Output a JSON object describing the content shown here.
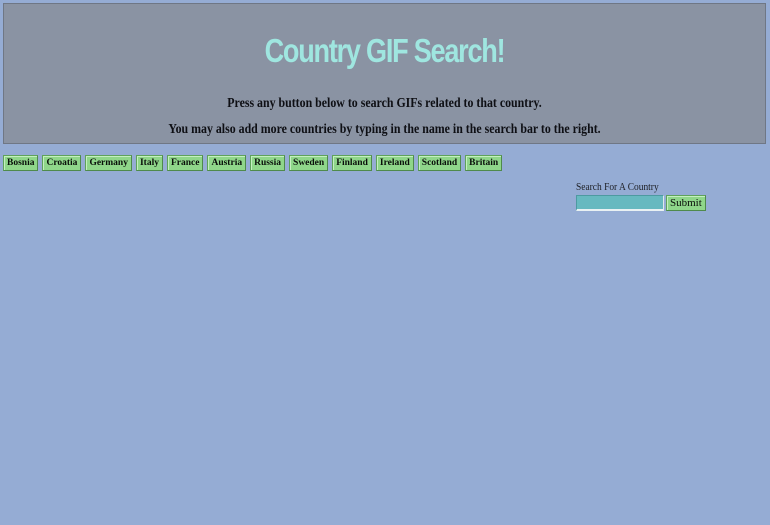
{
  "header": {
    "title": "Country GIF Search!",
    "instruction_1": "Press any button below to search GIFs related to that country.",
    "instruction_2": "You may also add more countries by typing in the name in the search bar to the right."
  },
  "countries": [
    "Bosnia",
    "Croatia",
    "Germany",
    "Italy",
    "France",
    "Austria",
    "Russia",
    "Sweden",
    "Finland",
    "Ireland",
    "Scotland",
    "Britain"
  ],
  "search": {
    "label": "Search For A Country",
    "value": "",
    "submit_label": "Submit"
  },
  "colors": {
    "page_background": "#95acd4",
    "header_background": "#8a93a3",
    "title_color": "#9fe6e0",
    "button_background": "#8fd68a",
    "input_background": "#67b9c0"
  }
}
